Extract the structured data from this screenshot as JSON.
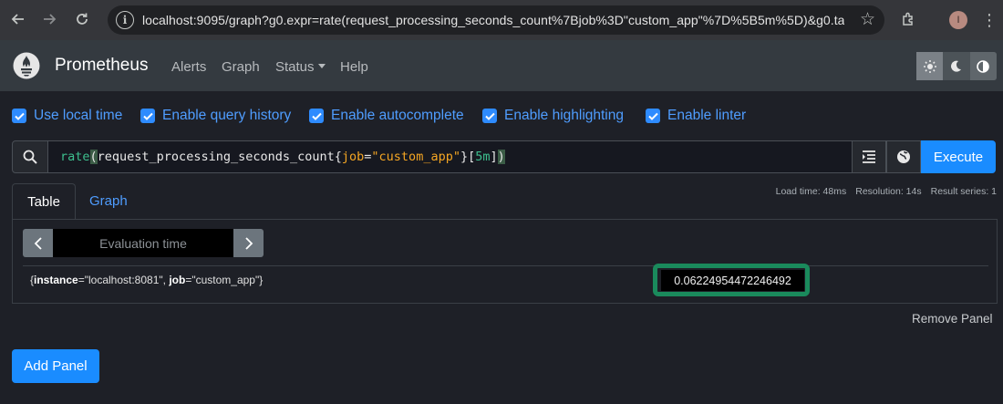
{
  "browser": {
    "url": "localhost:9095/graph?g0.expr=rate(request_processing_seconds_count%7Bjob%3D\"custom_app\"%7D%5B5m%5D)&g0.tab=1...",
    "profile_initial": "I"
  },
  "navbar": {
    "brand": "Prometheus",
    "links": {
      "alerts": "Alerts",
      "graph": "Graph",
      "status": "Status",
      "help": "Help"
    }
  },
  "options": [
    {
      "label": "Use local time",
      "checked": true
    },
    {
      "label": "Enable query history",
      "checked": true
    },
    {
      "label": "Enable autocomplete",
      "checked": true
    },
    {
      "label": "Enable highlighting",
      "checked": true
    },
    {
      "label": "Enable linter",
      "checked": true
    }
  ],
  "query": {
    "function": "rate",
    "metric": "request_processing_seconds_count",
    "label_name": "job",
    "label_value": "\"custom_app\"",
    "range": "5m",
    "execute_label": "Execute"
  },
  "tabs": {
    "table": "Table",
    "graph": "Graph",
    "active": "table"
  },
  "stats": {
    "load_time": "Load time: 48ms",
    "resolution": "Resolution: 14s",
    "result_series": "Result series: 1"
  },
  "table": {
    "evaluation_placeholder": "Evaluation time",
    "rows": [
      {
        "instance_key": "instance",
        "instance_value": "\"localhost:8081\"",
        "job_key": "job",
        "job_value": "\"custom_app\"",
        "value": "0.06224954472246492"
      }
    ]
  },
  "remove_panel": "Remove Panel",
  "add_panel": "Add Panel",
  "colors": {
    "accent": "#1a8cff",
    "link": "#4f9dff",
    "highlight_box": "#1a8a5c",
    "navbar": "#343a40",
    "background": "#1e2027"
  }
}
